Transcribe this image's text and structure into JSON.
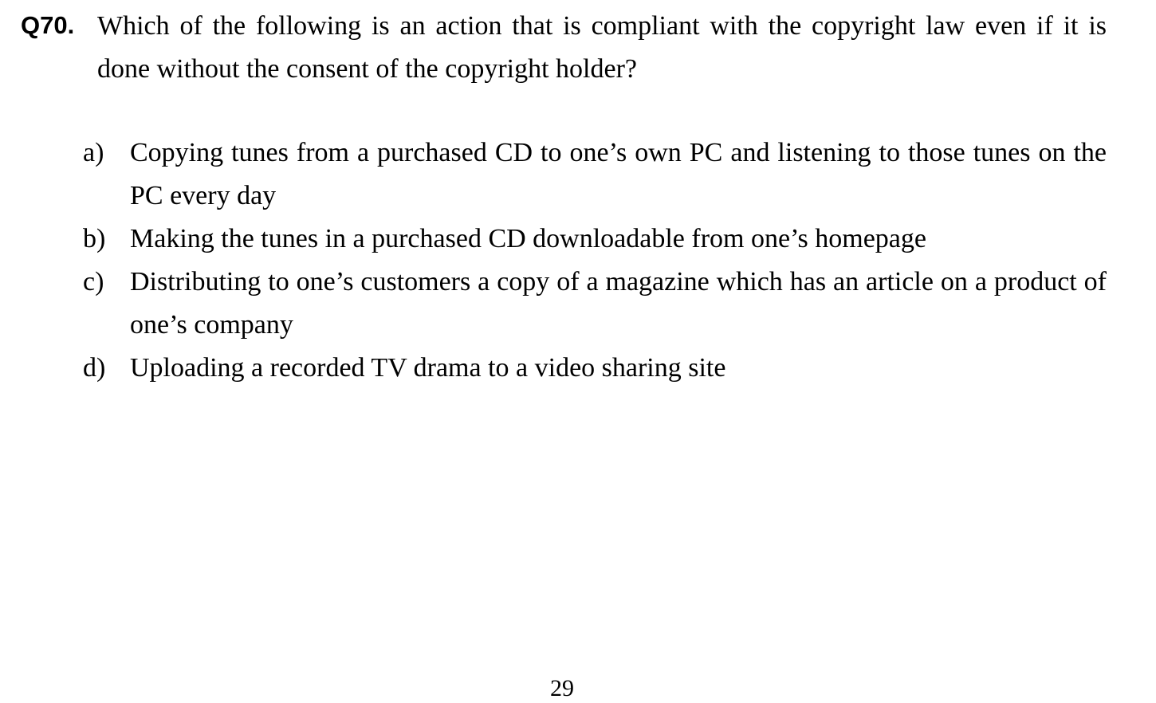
{
  "question": {
    "number": "Q70.",
    "text": "Which of the following is an action that is compliant with the copyright law even if it is done without the consent of the copyright holder?"
  },
  "options": [
    {
      "letter": "a)",
      "text": "Copying tunes from a purchased CD to one’s own PC and listening to those tunes on the PC every day"
    },
    {
      "letter": "b)",
      "text": "Making the tunes in a purchased CD downloadable from one’s homepage"
    },
    {
      "letter": "c)",
      "text": "Distributing to one’s customers a copy of a magazine which has an article on a product of one’s company"
    },
    {
      "letter": "d)",
      "text": "Uploading a recorded TV drama to a video sharing site"
    }
  ],
  "page_number": "29"
}
